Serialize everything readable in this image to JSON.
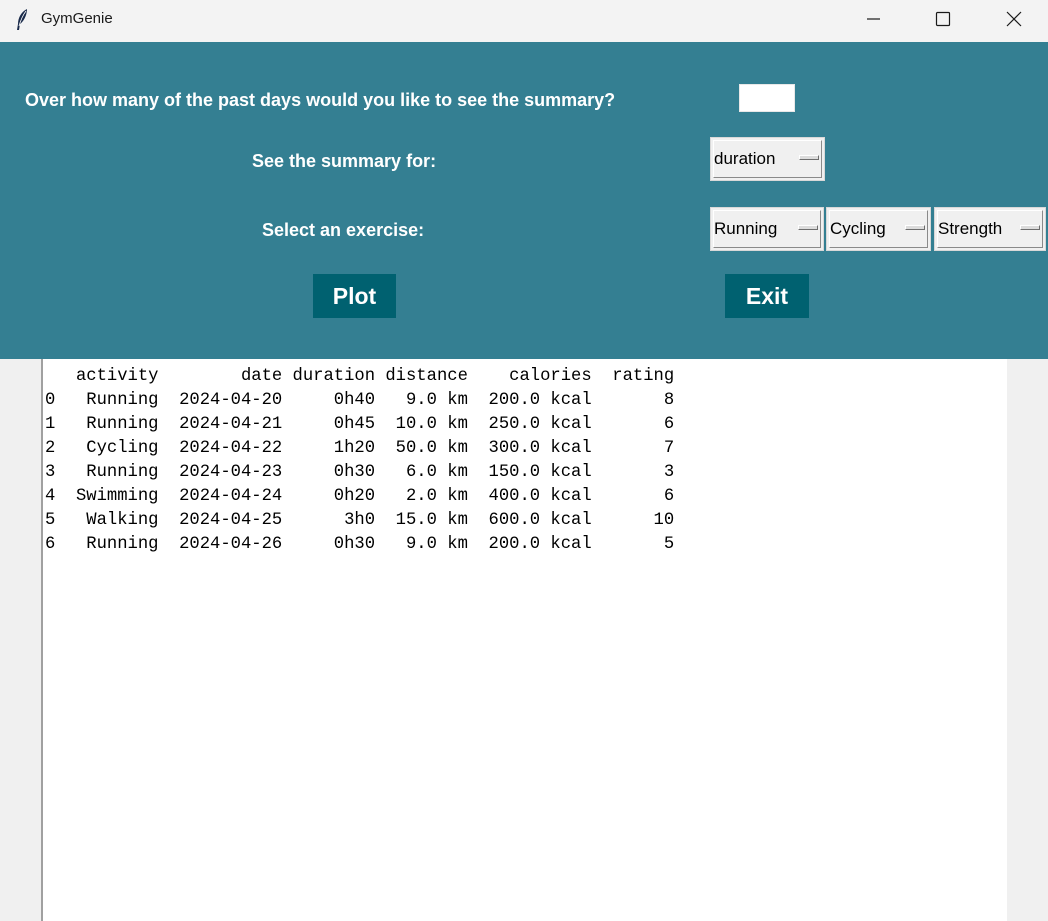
{
  "window": {
    "title": "GymGenie",
    "icon": "feather-icon"
  },
  "controls": {
    "days_question": "Over how many of the past days would you like to see the summary?",
    "days_value": "",
    "summary_label": "See the summary for:",
    "summary_selected": "duration",
    "exercise_label": "Select an exercise:",
    "exercise_menus": [
      "Running",
      "Cycling",
      "Strength"
    ],
    "plot_label": "Plot",
    "exit_label": "Exit"
  },
  "colors": {
    "panel": "#347f92",
    "button": "#006170"
  },
  "output": {
    "header": "   activity        date duration distance    calories  rating",
    "rows": [
      "0   Running  2024-04-20     0h40   9.0 km  200.0 kcal       8",
      "1   Running  2024-04-21     0h45  10.0 km  250.0 kcal       6",
      "2   Cycling  2024-04-22     1h20  50.0 km  300.0 kcal       7",
      "3   Running  2024-04-23     0h30   6.0 km  150.0 kcal       3",
      "4  Swimming  2024-04-24     0h20   2.0 km  400.0 kcal       6",
      "5   Walking  2024-04-25      3h0  15.0 km  600.0 kcal      10",
      "6   Running  2024-04-26     0h30   9.0 km  200.0 kcal       5"
    ]
  }
}
